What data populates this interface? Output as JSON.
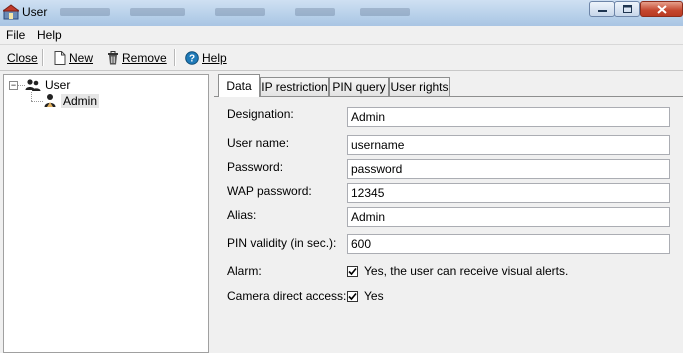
{
  "window": {
    "title": "User"
  },
  "menu": {
    "items": [
      "File",
      "Help"
    ]
  },
  "toolbar": {
    "close_label": "Close",
    "new_label": "New",
    "remove_label": "Remove",
    "help_label": "Help"
  },
  "tree": {
    "root_label": "User",
    "child_label": "Admin"
  },
  "tabs": [
    "Data",
    "IP restriction",
    "PIN query",
    "User rights"
  ],
  "form": {
    "designation_label": "Designation:",
    "designation_value": "Admin",
    "username_label": "User name:",
    "username_value": "username",
    "password_label": "Password:",
    "password_value": "password",
    "wap_label": "WAP password:",
    "wap_value": "12345",
    "alias_label": "Alias:",
    "alias_value": "Admin",
    "pin_label": "PIN validity (in sec.):",
    "pin_value": "600",
    "alarm_label": "Alarm:",
    "alarm_text": "Yes, the user can receive visual alerts.",
    "alarm_checked": true,
    "camera_label": "Camera direct access:",
    "camera_text": "Yes",
    "camera_checked": true
  },
  "colors": {
    "titlebar": "#b9d1ea",
    "close_button": "#c4472f",
    "panel_bg": "#f0f0f0"
  }
}
